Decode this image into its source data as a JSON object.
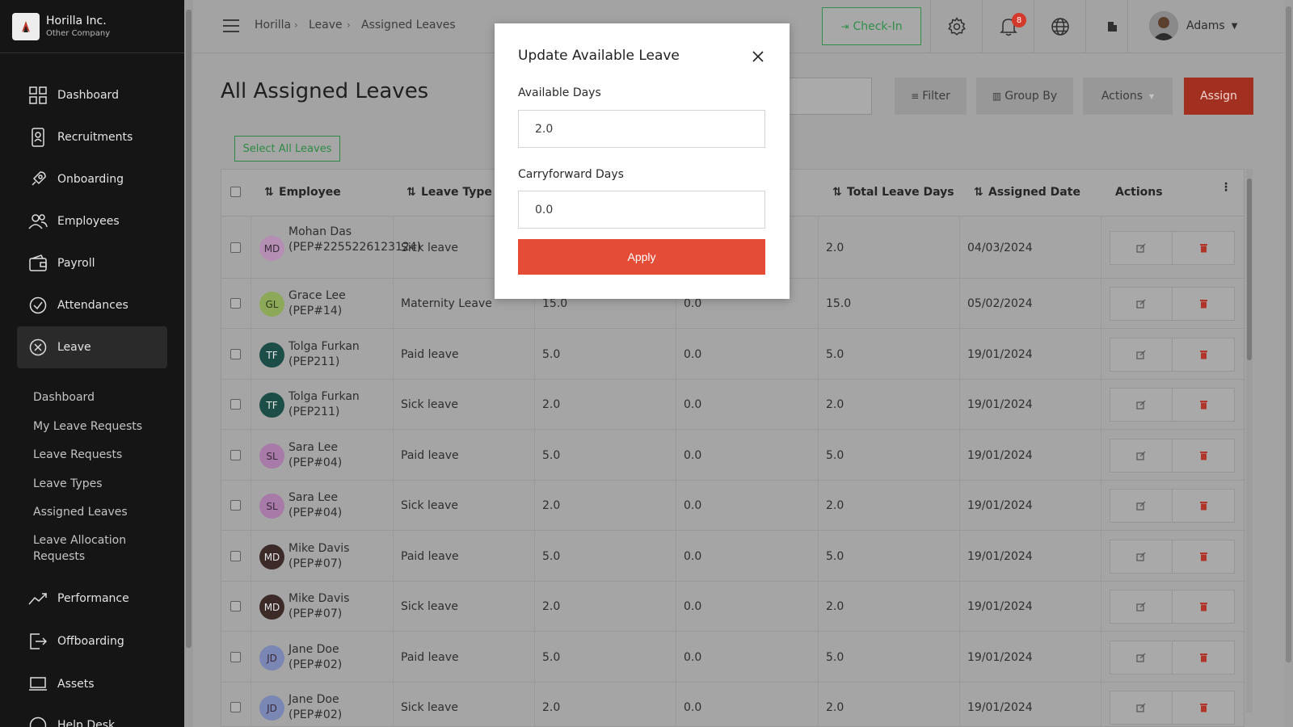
{
  "company": {
    "name": "Horilla Inc.",
    "sub": "Other Company"
  },
  "sidebar": {
    "items": [
      {
        "label": "Dashboard",
        "icon": "dashboard-icon"
      },
      {
        "label": "Recruitments",
        "icon": "recruitment-icon"
      },
      {
        "label": "Onboarding",
        "icon": "rocket-icon"
      },
      {
        "label": "Employees",
        "icon": "users-icon"
      },
      {
        "label": "Payroll",
        "icon": "wallet-icon"
      },
      {
        "label": "Attendances",
        "icon": "check-circle-icon"
      },
      {
        "label": "Leave",
        "icon": "x-circle-icon"
      },
      {
        "label": "Performance",
        "icon": "trend-icon"
      },
      {
        "label": "Offboarding",
        "icon": "exit-icon"
      },
      {
        "label": "Assets",
        "icon": "laptop-icon"
      },
      {
        "label": "Help Desk",
        "icon": "help-icon"
      }
    ],
    "leave_sub": [
      "Dashboard",
      "My Leave Requests",
      "Leave Requests",
      "Leave Types",
      "Assigned Leaves",
      "Leave Allocation Requests"
    ]
  },
  "header": {
    "breadcrumb": [
      "Horilla",
      "Leave",
      "Assigned Leaves"
    ],
    "checkin": "Check-In",
    "notif_count": "8",
    "user": "Adams"
  },
  "main": {
    "title": "All Assigned Leaves",
    "filter": "Filter",
    "group_by": "Group By",
    "actions": "Actions",
    "assign": "Assign",
    "select_all": "Select All Leaves"
  },
  "table": {
    "headers": {
      "employee": "Employee",
      "leave_type": "Leave Type",
      "total": "Total Leave Days",
      "assigned": "Assigned Date",
      "actions": "Actions"
    },
    "rows": [
      {
        "initials": "MD",
        "name": "Mohan Das (PEP#2255226123124)",
        "type": "Sick leave",
        "available": "",
        "carry": "",
        "total": "2.0",
        "date": "04/03/2024",
        "color": "#b48fb3"
      },
      {
        "initials": "GL",
        "name": "Grace Lee (PEP#14)",
        "type": "Maternity Leave",
        "available": "15.0",
        "carry": "0.0",
        "total": "15.0",
        "date": "05/02/2024",
        "color": "#8ea85a"
      },
      {
        "initials": "TF",
        "name": "Tolga Furkan (PEP211)",
        "type": "Paid leave",
        "available": "5.0",
        "carry": "0.0",
        "total": "5.0",
        "date": "19/01/2024",
        "color": "#1d4d47"
      },
      {
        "initials": "TF",
        "name": "Tolga Furkan (PEP211)",
        "type": "Sick leave",
        "available": "2.0",
        "carry": "0.0",
        "total": "2.0",
        "date": "19/01/2024",
        "color": "#1d4d47"
      },
      {
        "initials": "SL",
        "name": "Sara Lee (PEP#04)",
        "type": "Paid leave",
        "available": "5.0",
        "carry": "0.0",
        "total": "5.0",
        "date": "19/01/2024",
        "color": "#a77aa7"
      },
      {
        "initials": "SL",
        "name": "Sara Lee (PEP#04)",
        "type": "Sick leave",
        "available": "2.0",
        "carry": "0.0",
        "total": "2.0",
        "date": "19/01/2024",
        "color": "#a77aa7"
      },
      {
        "initials": "MD",
        "name": "Mike Davis (PEP#07)",
        "type": "Paid leave",
        "available": "5.0",
        "carry": "0.0",
        "total": "5.0",
        "date": "19/01/2024",
        "color": "#3b2a28"
      },
      {
        "initials": "MD",
        "name": "Mike Davis (PEP#07)",
        "type": "Sick leave",
        "available": "2.0",
        "carry": "0.0",
        "total": "2.0",
        "date": "19/01/2024",
        "color": "#3b2a28"
      },
      {
        "initials": "JD",
        "name": "Jane Doe (PEP#02)",
        "type": "Paid leave",
        "available": "5.0",
        "carry": "0.0",
        "total": "5.0",
        "date": "19/01/2024",
        "color": "#7a86b3"
      },
      {
        "initials": "JD",
        "name": "Jane Doe (PEP#02)",
        "type": "Sick leave",
        "available": "2.0",
        "carry": "0.0",
        "total": "2.0",
        "date": "19/01/2024",
        "color": "#7a86b3"
      }
    ]
  },
  "modal": {
    "title": "Update Available Leave",
    "available_label": "Available Days",
    "available_value": "2.0",
    "carry_label": "Carryforward Days",
    "carry_value": "0.0",
    "apply": "Apply"
  }
}
